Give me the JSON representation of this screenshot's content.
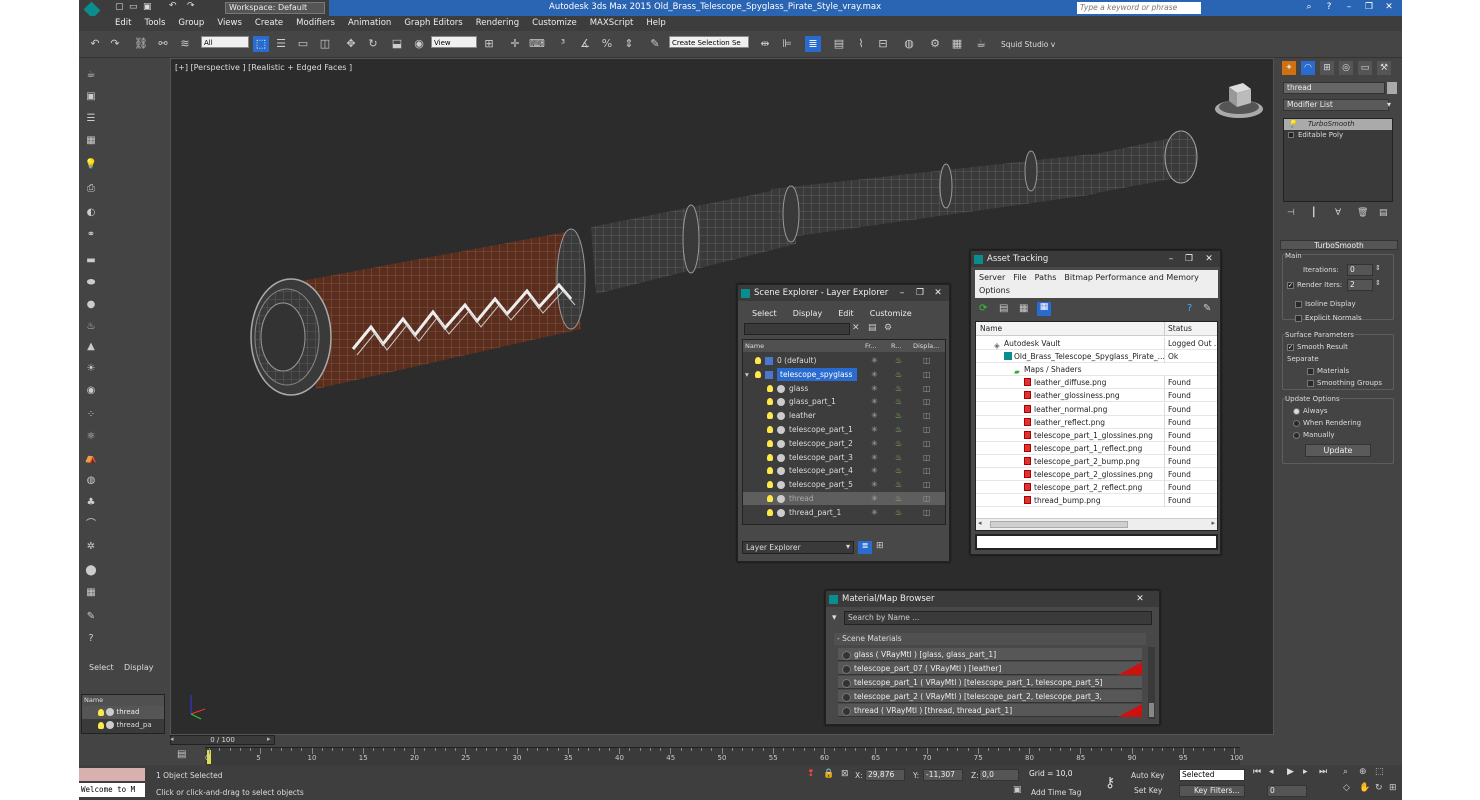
{
  "app": {
    "title": "Autodesk 3ds Max 2015     Old_Brass_Telescope_Spyglass_Pirate_Style_vray.max",
    "workspace": "Workspace: Default",
    "search_placeholder": "Type a keyword or phrase",
    "logo": "MAX"
  },
  "menu": [
    "Edit",
    "Tools",
    "Group",
    "Views",
    "Create",
    "Modifiers",
    "Animation",
    "Graph Editors",
    "Rendering",
    "Customize",
    "MAXScript",
    "Help"
  ],
  "toolbar": {
    "filter": "All",
    "ref_coord": "View",
    "selection_set": "Create Selection Se",
    "studio": "Squid Studio v"
  },
  "left_panel": {
    "tabs": [
      "Select",
      "Display"
    ],
    "name_header": "Name",
    "items": [
      "thread",
      "thread_pa"
    ]
  },
  "viewport": {
    "label": "[+] [Perspective ] [Realistic + Edged Faces ]"
  },
  "scene_explorer": {
    "title": "Scene Explorer - Layer Explorer",
    "menu": [
      "Select",
      "Display",
      "Edit",
      "Customize"
    ],
    "columns": [
      "Name",
      "Fr...",
      "R...",
      "Displa..."
    ],
    "rows": [
      {
        "name": "0 (default)",
        "level": 0
      },
      {
        "name": "telescope_spyglass",
        "level": 0,
        "selected": true
      },
      {
        "name": "glass",
        "level": 1
      },
      {
        "name": "glass_part_1",
        "level": 1
      },
      {
        "name": "leather",
        "level": 1
      },
      {
        "name": "telescope_part_1",
        "level": 1
      },
      {
        "name": "telescope_part_2",
        "level": 1
      },
      {
        "name": "telescope_part_3",
        "level": 1
      },
      {
        "name": "telescope_part_4",
        "level": 1
      },
      {
        "name": "telescope_part_5",
        "level": 1
      },
      {
        "name": "thread",
        "level": 1,
        "highlight": true
      },
      {
        "name": "thread_part_1",
        "level": 1
      }
    ],
    "footer": "Layer Explorer"
  },
  "asset_tracking": {
    "title": "Asset Tracking",
    "menu": [
      "Server",
      "File",
      "Paths",
      "Bitmap Performance and Memory"
    ],
    "menu2": "Options",
    "columns": [
      "Name",
      "Status"
    ],
    "rows": [
      {
        "name": "Autodesk Vault",
        "status": "Logged Out ...",
        "level": 0,
        "icon": "vault"
      },
      {
        "name": "Old_Brass_Telescope_Spyglass_Pirate_...",
        "status": "Ok",
        "level": 1,
        "icon": "max"
      },
      {
        "name": "Maps / Shaders",
        "status": "",
        "level": 2,
        "icon": "maps"
      },
      {
        "name": "leather_diffuse.png",
        "status": "Found",
        "level": 3,
        "icon": "png"
      },
      {
        "name": "leather_glossiness.png",
        "status": "Found",
        "level": 3,
        "icon": "png"
      },
      {
        "name": "leather_normal.png",
        "status": "Found",
        "level": 3,
        "icon": "png"
      },
      {
        "name": "leather_reflect.png",
        "status": "Found",
        "level": 3,
        "icon": "png"
      },
      {
        "name": "telescope_part_1_glossines.png",
        "status": "Found",
        "level": 3,
        "icon": "png"
      },
      {
        "name": "telescope_part_1_reflect.png",
        "status": "Found",
        "level": 3,
        "icon": "png"
      },
      {
        "name": "telescope_part_2_bump.png",
        "status": "Found",
        "level": 3,
        "icon": "png"
      },
      {
        "name": "telescope_part_2_glossines.png",
        "status": "Found",
        "level": 3,
        "icon": "png"
      },
      {
        "name": "telescope_part_2_reflect.png",
        "status": "Found",
        "level": 3,
        "icon": "png"
      },
      {
        "name": "thread_bump.png",
        "status": "Found",
        "level": 3,
        "icon": "png"
      }
    ]
  },
  "material_browser": {
    "title": "Material/Map Browser",
    "search_placeholder": "Search by Name ...",
    "section": "- Scene Materials",
    "rows": [
      {
        "text": "glass  ( VRayMtl ) [glass, glass_part_1]",
        "flag": false
      },
      {
        "text": "telescope_part_07  ( VRayMtl ) [leather]",
        "flag": true
      },
      {
        "text": "telescope_part_1  ( VRayMtl ) [telescope_part_1, telescope_part_5]",
        "flag": false
      },
      {
        "text": "telescope_part_2  ( VRayMtl ) [telescope_part_2, telescope_part_3, telescope_...",
        "flag": false
      },
      {
        "text": "thread  ( VRayMtl ) [thread, thread_part_1]",
        "flag": true
      }
    ]
  },
  "command_panel": {
    "object_name": "thread",
    "modifier_list": "Modifier List",
    "stack": [
      "TurboSmooth",
      "Editable Poly"
    ],
    "rollout_title": "TurboSmooth",
    "main_label": "Main",
    "iterations_label": "Iterations:",
    "iterations": "0",
    "render_iters_label": "Render Iters:",
    "render_iters": "2",
    "render_iters_checked": true,
    "isoline_label": "Isoline Display",
    "explicit_label": "Explicit Normals",
    "surface_label": "Surface Parameters",
    "smooth_result_label": "Smooth Result",
    "separate_label": "Separate",
    "materials_label": "Materials",
    "smoothing_groups_label": "Smoothing Groups",
    "update_options_label": "Update Options",
    "always_label": "Always",
    "when_rendering_label": "When Rendering",
    "manually_label": "Manually",
    "update_button": "Update"
  },
  "timeline": {
    "frame_label": "0 / 100",
    "ticks": [
      "0",
      "5",
      "10",
      "15",
      "20",
      "25",
      "30",
      "35",
      "40",
      "45",
      "50",
      "55",
      "60",
      "65",
      "70",
      "75",
      "80",
      "85",
      "90",
      "95",
      "100"
    ]
  },
  "status": {
    "maxscript": "Welcome to M",
    "selected": "1 Object Selected",
    "prompt": "Click or click-and-drag to select objects",
    "x_label": "X:",
    "x": "29,876",
    "y_label": "Y:",
    "y": "-11,307",
    "z_label": "Z:",
    "z": "0,0",
    "grid": "Grid = 10,0",
    "add_time_tag": "Add Time Tag",
    "auto_key": "Auto Key",
    "set_key": "Set Key",
    "key_mode": "Selected",
    "key_filters": "Key Filters...",
    "frame": "0"
  },
  "colors": {
    "title_bar": "#2a65b3",
    "accent_teal": "#0b8d8f",
    "selection_blue": "#2a6bd0",
    "found_red": "#c11"
  }
}
